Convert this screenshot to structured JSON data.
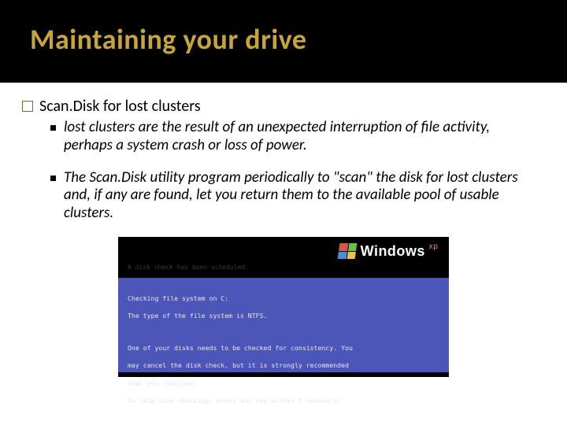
{
  "title": "Maintaining your drive",
  "topItem": "Scan.Disk for lost clusters",
  "sub1": "lost clusters are the result of an unexpected interruption of file activity, perhaps a system crash or loss of power.",
  "sub2": "The Scan.Disk utility program periodically to \"scan\" the disk for lost clusters and, if any are found, let you return them to the available pool of usable clusters.",
  "screenshot": {
    "brand": "Windows",
    "edition": "xp",
    "faintLine": "A disk check has been scheduled.",
    "line1": "Checking file system on C:",
    "line2": "The type of the file system is NTFS.",
    "line3": "One of your disks needs to be checked for consistency. You",
    "line4": "may cancel the disk check, but it is strongly recommended",
    "line5": "that you continue.",
    "line6": "To skip disk checking, press any key within 7 second(s)."
  }
}
